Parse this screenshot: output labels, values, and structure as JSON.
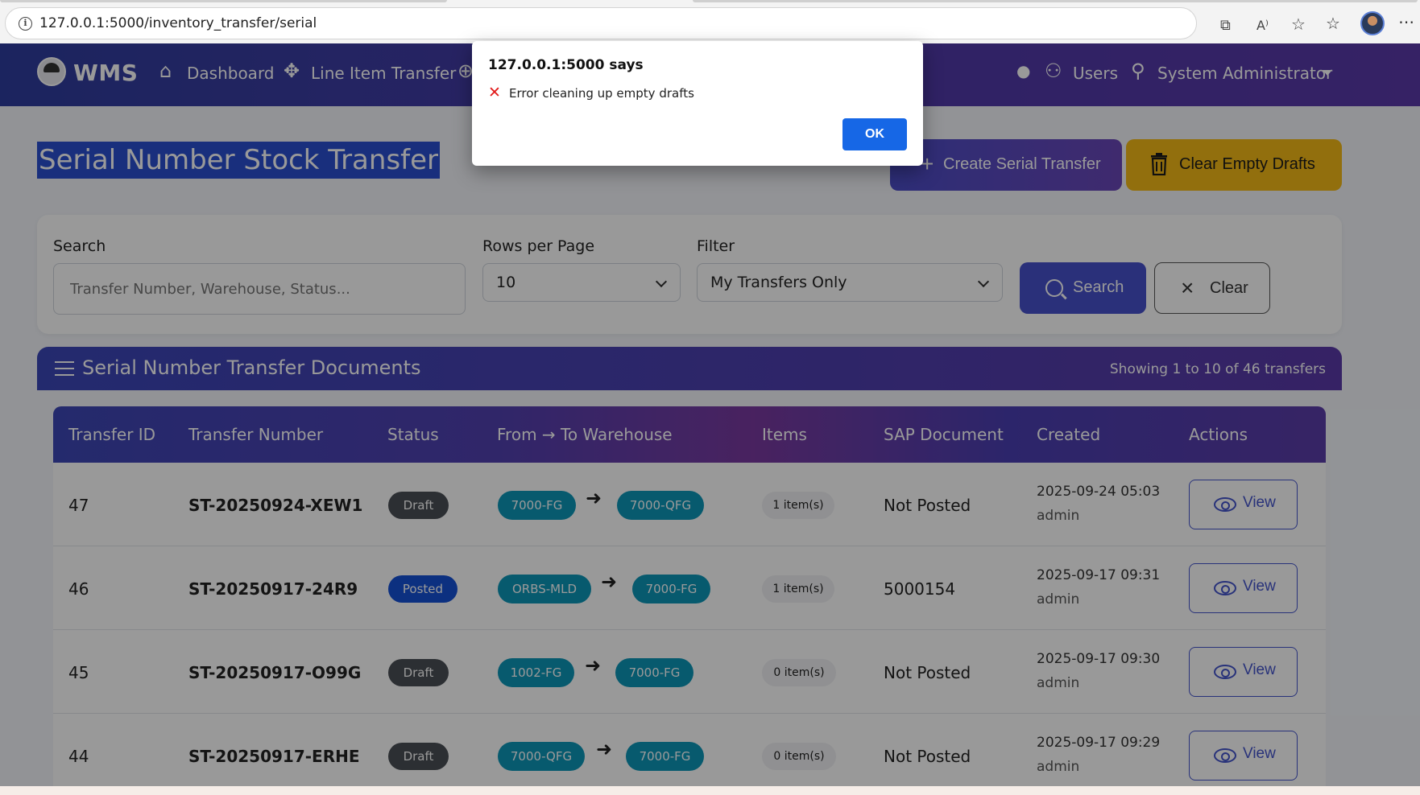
{
  "browser": {
    "url": "127.0.0.1:5000/inventory_transfer/serial"
  },
  "nav": {
    "brand": "WMS",
    "items": [
      {
        "label": "Dashboard"
      },
      {
        "label": "Line Item Transfer"
      }
    ],
    "right": [
      {
        "label": "Users"
      },
      {
        "label": "System Administrator"
      }
    ]
  },
  "page": {
    "title": "Serial Number Stock Transfer",
    "create_button": "Create Serial Transfer",
    "clear_drafts_button": "Clear Empty Drafts"
  },
  "filters": {
    "search_label": "Search",
    "search_placeholder": "Transfer Number, Warehouse, Status...",
    "rows_label": "Rows per Page",
    "rows_value": "10",
    "filter_label": "Filter",
    "filter_value": "My Transfers Only",
    "search_button": "Search",
    "clear_button": "Clear"
  },
  "documents": {
    "title": "Serial Number Transfer Documents",
    "summary": "Showing 1 to 10 of 46 transfers",
    "columns": [
      "Transfer ID",
      "Transfer Number",
      "Status",
      "From → To Warehouse",
      "Items",
      "SAP Document",
      "Created",
      "Actions"
    ],
    "rows": [
      {
        "id": "47",
        "number": "ST-20250924-XEW1",
        "status": "Draft",
        "from": "7000-FG",
        "to": "7000-QFG",
        "items": "1 item(s)",
        "sap": "Not Posted",
        "date": "2025-09-24 05:03",
        "by": "admin",
        "action": "View"
      },
      {
        "id": "46",
        "number": "ST-20250917-24R9",
        "status": "Posted",
        "from": "ORBS-MLD",
        "to": "7000-FG",
        "items": "1 item(s)",
        "sap": "5000154",
        "date": "2025-09-17 09:31",
        "by": "admin",
        "action": "View"
      },
      {
        "id": "45",
        "number": "ST-20250917-O99G",
        "status": "Draft",
        "from": "1002-FG",
        "to": "7000-FG",
        "items": "0 item(s)",
        "sap": "Not Posted",
        "date": "2025-09-17 09:30",
        "by": "admin",
        "action": "View"
      },
      {
        "id": "44",
        "number": "ST-20250917-ERHE",
        "status": "Draft",
        "from": "7000-QFG",
        "to": "7000-FG",
        "items": "0 item(s)",
        "sap": "Not Posted",
        "date": "2025-09-17 09:29",
        "by": "admin",
        "action": "View"
      }
    ]
  },
  "dialog": {
    "title": "127.0.0.1:5000 says",
    "icon": "cross-mark-icon",
    "message": "Error cleaning up empty drafts",
    "ok": "OK"
  },
  "colors": {
    "nav_start": "#2e3d9e",
    "nav_end": "#5a3aa8",
    "warning": "#f3b917",
    "warehouse_pill": "#0d96b8",
    "posted": "#1450d6",
    "draft": "#4a4f55",
    "ok_button": "#1667e6"
  }
}
